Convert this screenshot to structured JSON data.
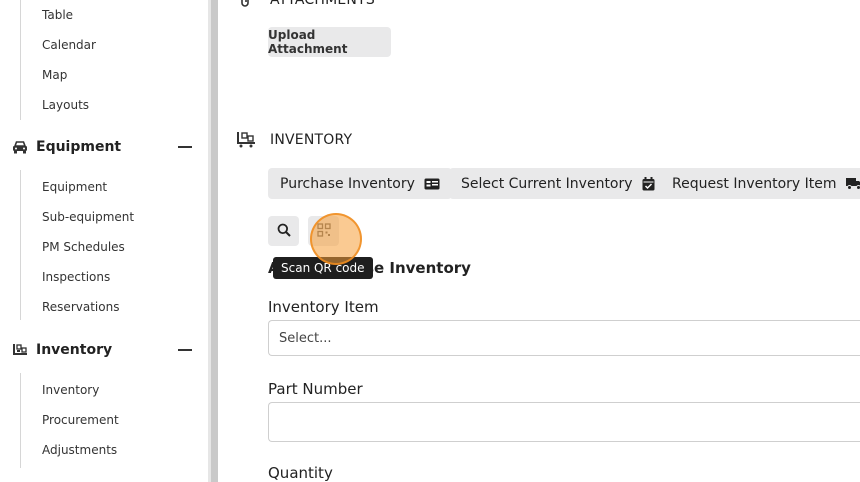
{
  "sidebar": {
    "top_items": [
      "Table",
      "Calendar",
      "Map",
      "Layouts"
    ],
    "sections": [
      {
        "label": "Equipment",
        "icon": "car-icon",
        "items": [
          "Equipment",
          "Sub-equipment",
          "PM Schedules",
          "Inspections",
          "Reservations"
        ]
      },
      {
        "label": "Inventory",
        "icon": "pallet-icon",
        "items": [
          "Inventory",
          "Procurement",
          "Adjustments"
        ]
      }
    ]
  },
  "attachments": {
    "title": "ATTACHMENTS",
    "upload_label": "Upload Attachment"
  },
  "inventory": {
    "title": "INVENTORY",
    "buttons": {
      "purchase": "Purchase Inventory",
      "select_current": "Select Current Inventory",
      "request": "Request Inventory Item"
    },
    "tooltip": "Scan QR code",
    "form_heading": "Add Purchase Inventory",
    "fields": {
      "item_label": "Inventory Item",
      "item_placeholder": "Select...",
      "part_label": "Part Number",
      "part_value": "",
      "qty_label": "Quantity"
    }
  },
  "colors": {
    "button_bg": "#e9e9ea",
    "tooltip_bg": "#1f1f1f",
    "cursor_highlight": "#f69e38"
  }
}
